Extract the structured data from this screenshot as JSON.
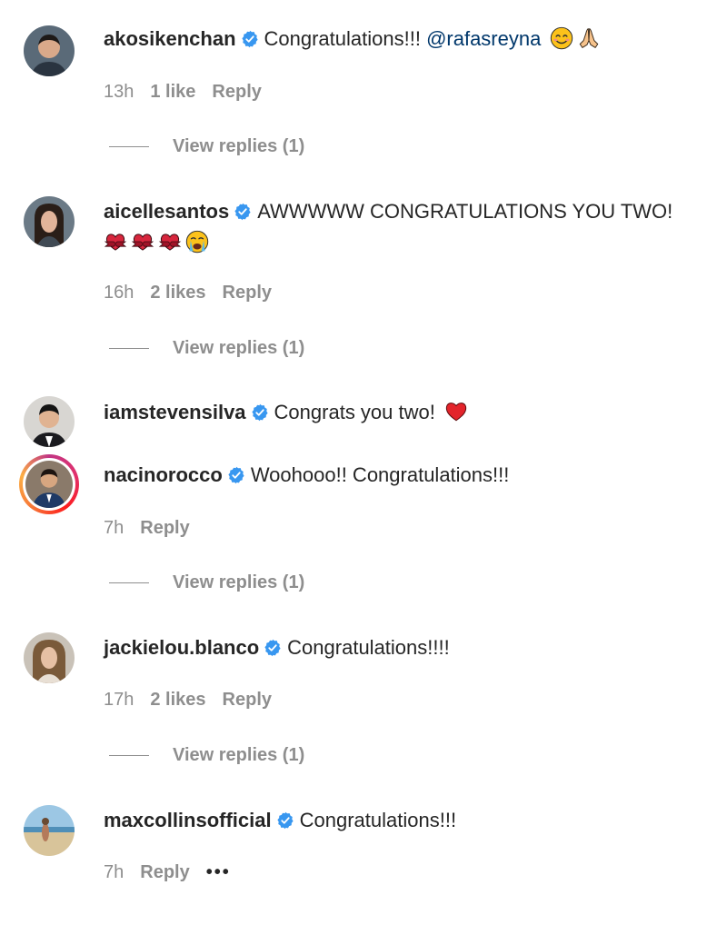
{
  "comments": [
    {
      "username": "akosikenchan",
      "text": "Congratulations!!! ",
      "mention": "@rafasreyna",
      "time": "13h",
      "likes": "1 like",
      "reply": "Reply",
      "view_replies": "View replies (1)"
    },
    {
      "username": "aicellesantos",
      "text": "AWWWWW CONGRATULATIONS YOU TWO!",
      "time": "16h",
      "likes": "2 likes",
      "reply": "Reply",
      "view_replies": "View replies (1)"
    },
    {
      "username": "iamstevensilva",
      "text": "Congrats you two!"
    },
    {
      "username": "nacinorocco",
      "text": "Woohooo!! Congratulations!!!",
      "time": "7h",
      "reply": "Reply",
      "view_replies": "View replies (1)"
    },
    {
      "username": "jackielou.blanco",
      "text": "Congratulations!!!!",
      "time": "17h",
      "likes": "2 likes",
      "reply": "Reply",
      "view_replies": "View replies (1)"
    },
    {
      "username": "maxcollinsofficial",
      "text": "Congratulations!!!",
      "time": "7h",
      "reply": "Reply",
      "more": "•••"
    }
  ],
  "icons": {
    "verified": "verified-badge-icon",
    "smile": "smiling-face-emoji",
    "pray": "folded-hands-emoji",
    "heart_ribbon": "heart-with-ribbon-emoji",
    "crying": "loudly-crying-face-emoji",
    "red_heart": "red-heart-emoji"
  },
  "colors": {
    "verified_blue": "#3897f0",
    "username": "#262626",
    "meta_gray": "#8e8e8e",
    "mention": "#00376b"
  }
}
